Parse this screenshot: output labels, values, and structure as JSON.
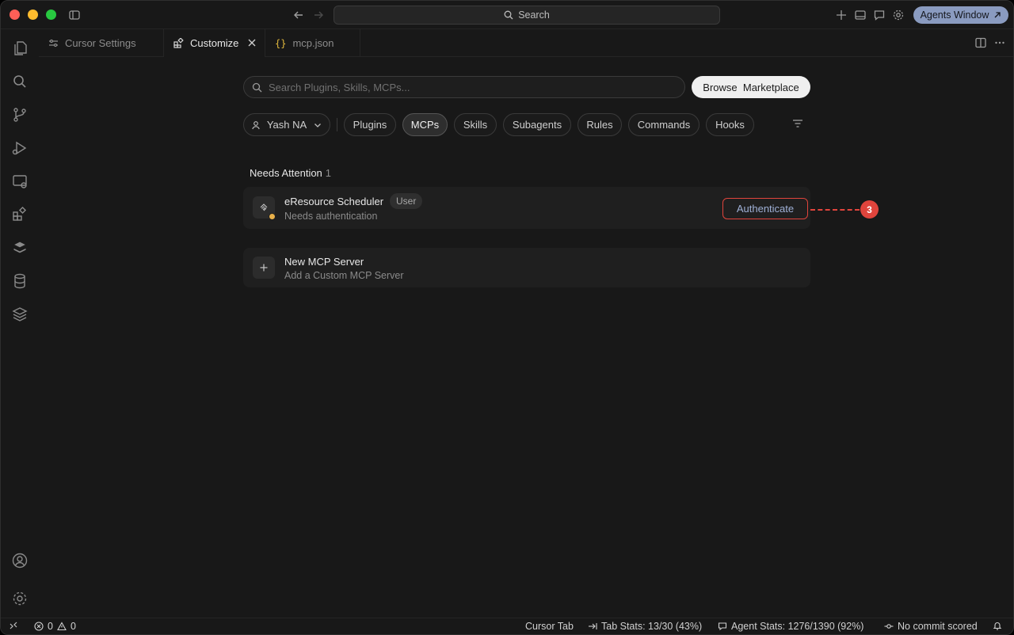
{
  "titlebar": {
    "search_label": "Search",
    "agents_button": "Agents Window"
  },
  "tabs": [
    {
      "label": "Cursor Settings"
    },
    {
      "label": "Customize"
    },
    {
      "label": "mcp.json"
    }
  ],
  "customize": {
    "search_placeholder": "Search Plugins, Skills, MCPs...",
    "browse_button": "Browse  Marketplace",
    "user_selector": "Yash NA",
    "filters": [
      "Plugins",
      "MCPs",
      "Skills",
      "Subagents",
      "Rules",
      "Commands",
      "Hooks"
    ],
    "active_filter": "MCPs"
  },
  "needs_attention": {
    "title": "Needs Attention",
    "count": "1",
    "server": {
      "name": "eResource Scheduler",
      "badge": "User",
      "status": "Needs authentication",
      "action": "Authenticate"
    }
  },
  "new_server": {
    "title": "New MCP Server",
    "subtitle": "Add a Custom MCP Server"
  },
  "annotation": {
    "number": "3"
  },
  "statusbar": {
    "errors": "0",
    "warnings": "0",
    "cursor_tab": "Cursor Tab",
    "tab_stats": "Tab Stats: 13/30 (43%)",
    "agent_stats": "Agent Stats: 1276/1390 (92%)",
    "commit": "No commit scored"
  },
  "colors": {
    "accent_red": "#e0443c",
    "status_pending": "#e8b04a",
    "agents_button_bg": "#8a9bc0"
  }
}
